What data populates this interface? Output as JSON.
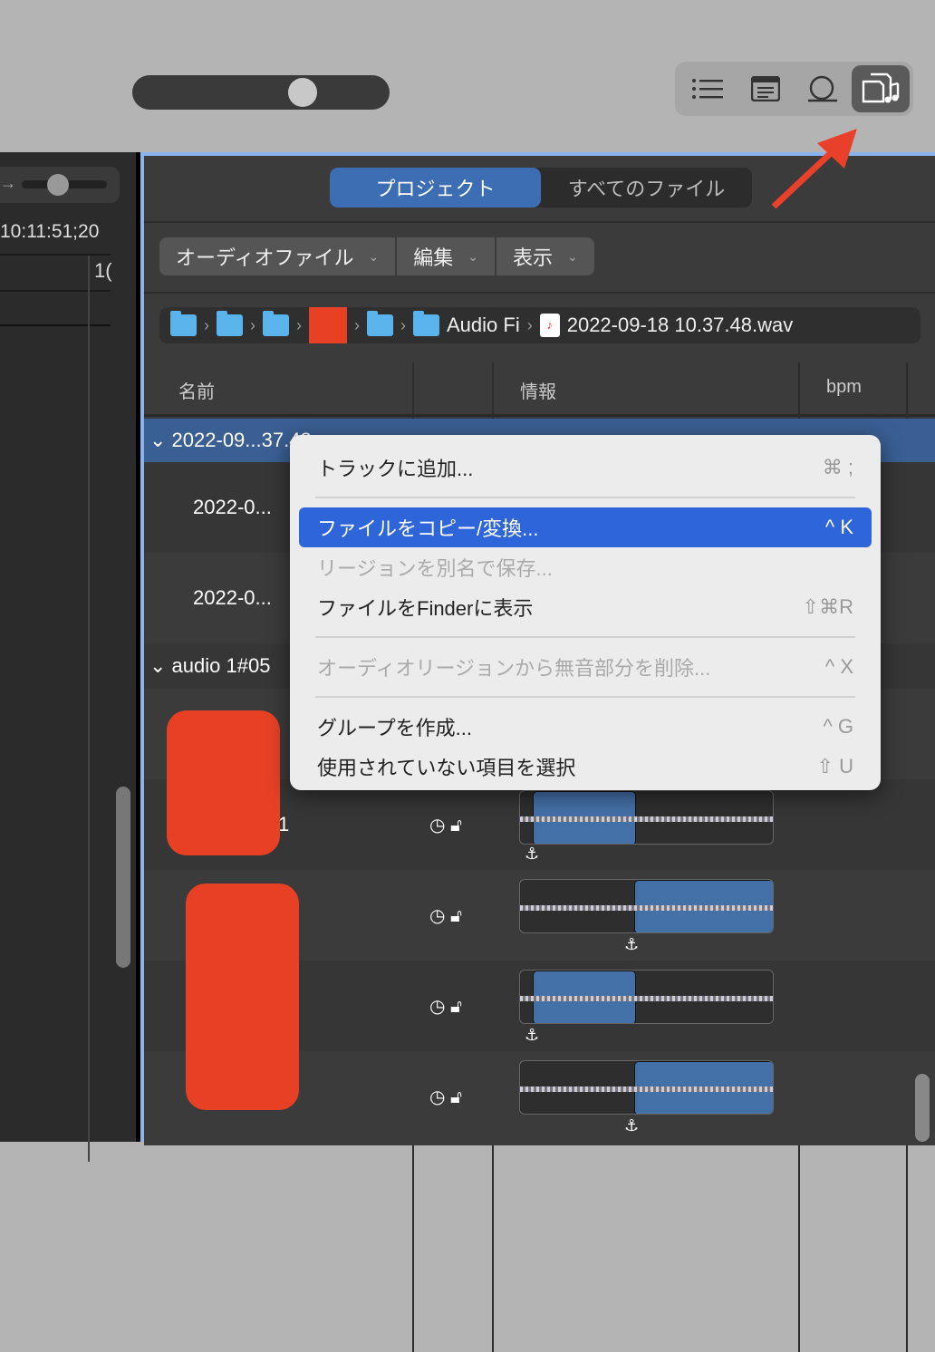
{
  "timeline": {
    "timecode": "10:11:51;20",
    "ruler_label": "1("
  },
  "view_buttons": [
    {
      "icon": "list-icon"
    },
    {
      "icon": "notes-icon"
    },
    {
      "icon": "loop-icon"
    },
    {
      "icon": "browser-icon",
      "active": true
    }
  ],
  "browser": {
    "tabs": [
      {
        "label": "プロジェクト",
        "active": true
      },
      {
        "label": "すべてのファイル"
      }
    ],
    "menus": [
      "オーディオファイル",
      "編集",
      "表示"
    ],
    "path": {
      "folder_label": "Audio Fi",
      "file": "2022-09-18 10.37.48.wav"
    },
    "columns": {
      "name": "名前",
      "info": "情報",
      "bpm": "bpm"
    },
    "rows": [
      {
        "name": "2022-09...37.48",
        "selected": true
      },
      {
        "name": "2022-0..."
      },
      {
        "name": "2022-0..."
      },
      {
        "name": "audio 1#05"
      },
      {
        "name": "1"
      }
    ]
  },
  "context_menu": {
    "items": [
      {
        "label": "トラックに追加...",
        "shortcut": "⌘ ;"
      },
      {
        "label": "ファイルをコピー/変換...",
        "shortcut": "^ K",
        "highlighted": true
      },
      {
        "label": "リージョンを別名で保存...",
        "shortcut": "",
        "disabled": true
      },
      {
        "label": "ファイルをFinderに表示",
        "shortcut": "⇧⌘R"
      },
      {
        "label": "オーディオリージョンから無音部分を削除...",
        "shortcut": "^ X",
        "disabled": true
      },
      {
        "label": "グループを作成...",
        "shortcut": "^ G"
      },
      {
        "label": "使用されていない項目を選択",
        "shortcut": "⇧ U"
      }
    ]
  },
  "colors": {
    "accent": "#2e65d8",
    "redaction": "#e84025",
    "annotation_arrow": "#e8402a"
  }
}
